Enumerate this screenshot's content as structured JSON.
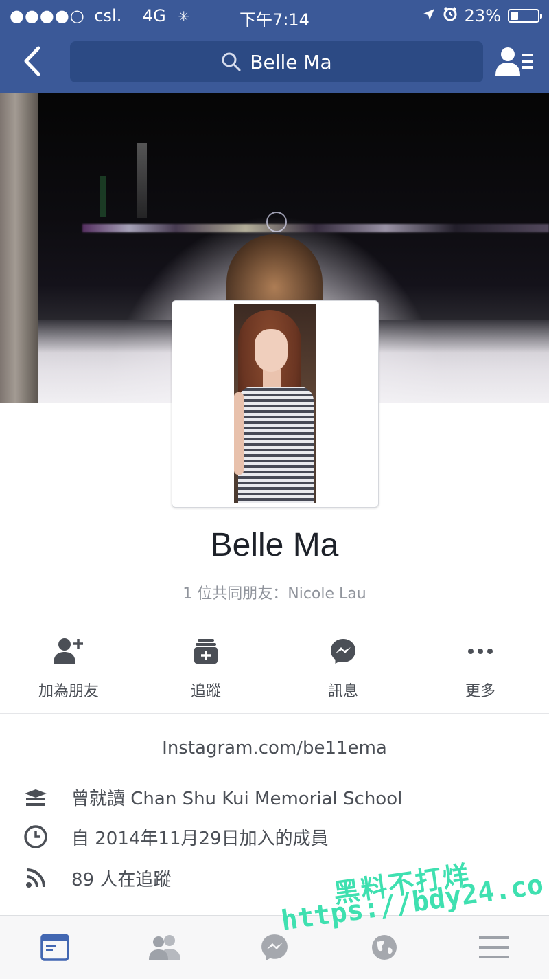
{
  "status_bar": {
    "signal_dots": "●●●●○",
    "carrier": "csl.",
    "network": "4G",
    "time": "下午7:14",
    "battery_percent": "23%",
    "battery_level": 0.23
  },
  "nav": {
    "search_text": "Belle Ma"
  },
  "profile": {
    "name": "Belle Ma",
    "mutual_friends": "1 位共同朋友：Nicole Lau"
  },
  "actions": [
    {
      "label": "加為朋友",
      "icon": "add-friend-icon"
    },
    {
      "label": "追蹤",
      "icon": "follow-icon"
    },
    {
      "label": "訊息",
      "icon": "messenger-icon"
    },
    {
      "label": "更多",
      "icon": "more-icon"
    }
  ],
  "about": {
    "website": "Instagram.com/be11ema",
    "education": "曾就讀 Chan Shu Kui Memorial School",
    "joined": "自 2014年11月29日加入的成員",
    "followers": "89 人在追蹤"
  },
  "bottom_tabs": [
    {
      "icon": "news-feed-icon",
      "active": true
    },
    {
      "icon": "friends-icon",
      "active": false
    },
    {
      "icon": "messenger-icon",
      "active": false
    },
    {
      "icon": "globe-icon",
      "active": false
    },
    {
      "icon": "menu-icon",
      "active": false
    }
  ],
  "watermark": {
    "line1": "黑料不打烊",
    "line2": "https://bdy24.co"
  },
  "colors": {
    "brand": "#3b5998",
    "active_tab": "#4267b2",
    "icon_gray": "#4b4f56"
  }
}
